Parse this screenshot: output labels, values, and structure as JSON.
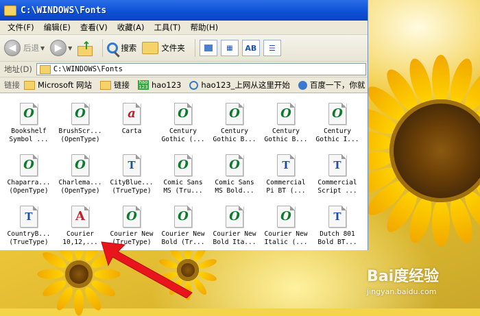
{
  "window": {
    "title": "C:\\WINDOWS\\Fonts"
  },
  "menu": [
    "文件(F)",
    "编辑(E)",
    "查看(V)",
    "收藏(A)",
    "工具(T)",
    "帮助(H)"
  ],
  "toolbar": {
    "back_label": "后退",
    "search_label": "搜索",
    "folders_label": "文件夹"
  },
  "address": {
    "label": "地址(D)",
    "value": "C:\\WINDOWS\\Fonts"
  },
  "links": {
    "label": "链接",
    "items": [
      "Microsoft 网站",
      "链接",
      "hao123",
      "hao123_上网从这里开始",
      "百度一下，你就"
    ]
  },
  "files": [
    {
      "line1": "Bookshelf",
      "line2": "Symbol ...",
      "icon": "o-opentype-icon"
    },
    {
      "line1": "BrushScr...",
      "line2": "(OpenType)",
      "icon": "o-opentype-icon"
    },
    {
      "line1": "Carta",
      "line2": "",
      "icon": "a-font-icon"
    },
    {
      "line1": "Century",
      "line2": "Gothic (...",
      "icon": "o-opentype-icon"
    },
    {
      "line1": "Century",
      "line2": "Gothic B...",
      "icon": "o-opentype-icon"
    },
    {
      "line1": "Century",
      "line2": "Gothic B...",
      "icon": "o-opentype-icon"
    },
    {
      "line1": "Century",
      "line2": "Gothic I...",
      "icon": "o-opentype-icon"
    },
    {
      "line1": "Chaparra...",
      "line2": "(OpenType)",
      "icon": "o-opentype-icon"
    },
    {
      "line1": "Charlema...",
      "line2": "(OpenType)",
      "icon": "o-opentype-icon"
    },
    {
      "line1": "CityBlue...",
      "line2": "(TrueType)",
      "icon": "tt-truetype-icon"
    },
    {
      "line1": "Comic Sans",
      "line2": "MS (Tru...",
      "icon": "o-opentype-icon"
    },
    {
      "line1": "Comic Sans",
      "line2": "MS Bold...",
      "icon": "o-opentype-icon"
    },
    {
      "line1": "Commercial",
      "line2": "Pi BT (...",
      "icon": "tt-truetype-icon"
    },
    {
      "line1": "Commercial",
      "line2": "Script ...",
      "icon": "tt-truetype-icon"
    },
    {
      "line1": "CountryB...",
      "line2": "(TrueType)",
      "icon": "tt-truetype-icon"
    },
    {
      "line1": "Courier",
      "line2": "10,12,...",
      "icon": "a-raster-icon"
    },
    {
      "line1": "Courier New",
      "line2": "(TrueType)",
      "icon": "o-opentype-icon"
    },
    {
      "line1": "Courier New",
      "line2": "Bold (Tr...",
      "icon": "o-opentype-icon"
    },
    {
      "line1": "Courier New",
      "line2": "Bold Ita...",
      "icon": "o-opentype-icon"
    },
    {
      "line1": "Courier New",
      "line2": "Italic (...",
      "icon": "o-opentype-icon"
    },
    {
      "line1": "Dutch 801",
      "line2": "Bold BT...",
      "icon": "tt-truetype-icon"
    }
  ],
  "watermark": {
    "main": "Bai度经验",
    "sub": "jingyan.baidu.com"
  }
}
